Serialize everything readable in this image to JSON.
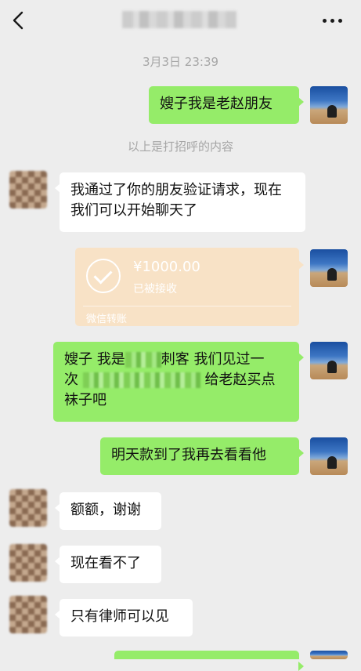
{
  "header": {
    "back_icon": "chevron-left-icon",
    "title_obscured": true,
    "more_icon": "more-dots-icon"
  },
  "timestamp": "3月3日 23:39",
  "greeting_note": "以上是打招呼的内容",
  "messages": [
    {
      "from": "me",
      "text": "嫂子我是老赵朋友"
    },
    {
      "from": "other",
      "text": "我通过了你的朋友验证请求，现在我们可以开始聊天了"
    },
    {
      "from": "me",
      "type": "transfer",
      "amount": "¥1000.00",
      "status": "已被接收",
      "label": "微信转账"
    },
    {
      "from": "me",
      "line1_a": "嫂子 我是",
      "line1_b": "刺客 我们见过一",
      "line2_a": "次",
      "line2_b": "给老赵买点",
      "line3": "袜子吧"
    },
    {
      "from": "me",
      "text": "明天款到了我再去看看他"
    },
    {
      "from": "other",
      "text": "额额，谢谢"
    },
    {
      "from": "other",
      "text": "现在看不了"
    },
    {
      "from": "other",
      "text": "只有律师可以见"
    }
  ],
  "colors": {
    "background": "#ededed",
    "my_bubble": "#95ec69",
    "other_bubble": "#ffffff",
    "transfer_received": "#f8e2c6",
    "system_text": "#a6a6a6"
  }
}
